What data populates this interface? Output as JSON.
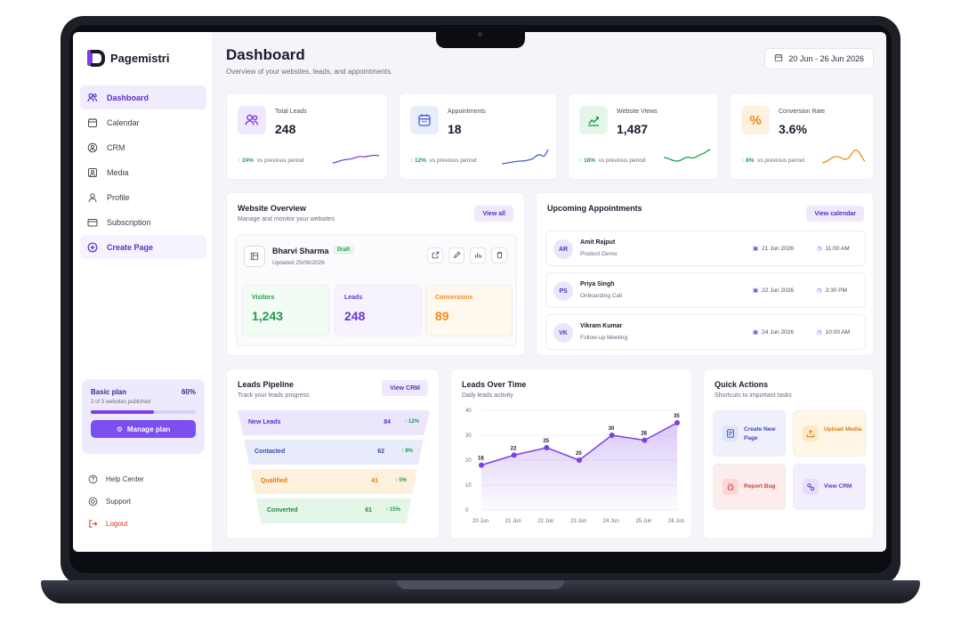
{
  "app": {
    "name": "Pagemistri"
  },
  "nav": {
    "items": [
      {
        "label": "Dashboard",
        "icon": "dashboard-icon"
      },
      {
        "label": "Calendar",
        "icon": "calendar-icon"
      },
      {
        "label": "CRM",
        "icon": "crm-icon"
      },
      {
        "label": "Media",
        "icon": "media-icon"
      },
      {
        "label": "Profile",
        "icon": "profile-icon"
      },
      {
        "label": "Subscription",
        "icon": "subscription-icon"
      },
      {
        "label": "Create Page",
        "icon": "plus-circle-icon"
      }
    ]
  },
  "plan": {
    "name": "Basic plan",
    "percent_label": "60%",
    "percent": 0.6,
    "sub": "2 of 3 websites published",
    "button": "Manage plan"
  },
  "footer_nav": {
    "help": "Help Center",
    "support": "Support",
    "logout": "Logout"
  },
  "header": {
    "title": "Dashboard",
    "subtitle": "Overview of your websites, leads, and appointments.",
    "date_range": "20 Jun - 26 Jun 2026"
  },
  "stats": [
    {
      "label": "Total Leads",
      "value": "248",
      "change": "↑ 24%",
      "note": "vs previous period",
      "color": "#7b3fe4",
      "bg": "#efe9fd",
      "icon": "users-icon"
    },
    {
      "label": "Appointments",
      "value": "18",
      "change": "↑ 12%",
      "note": "vs previous period",
      "color": "#4b5fd6",
      "bg": "#e9ecfb",
      "icon": "calendar-icon"
    },
    {
      "label": "Website Views",
      "value": "1,487",
      "change": "↑ 18%",
      "note": "vs previous period",
      "color": "#1f9d4c",
      "bg": "#e4f6ea",
      "icon": "chart-up-icon"
    },
    {
      "label": "Conversion Rate",
      "value": "3.6%",
      "change": "↑ 8%",
      "note": "vs previous period",
      "color": "#f08a1c",
      "bg": "#fdf1e2",
      "icon": "percent-icon"
    }
  ],
  "website_overview": {
    "title": "Website Overview",
    "subtitle": "Manage and monitor your websites",
    "button": "View all",
    "site": {
      "name": "Bharvi Sharma",
      "status": "Draft",
      "updated": "Updated 25/06/2026"
    },
    "metrics": [
      {
        "label": "Visitors",
        "value": "1,243",
        "color": "#1f9d4c",
        "bg": "#f3fbf5"
      },
      {
        "label": "Leads",
        "value": "248",
        "color": "#6a33d8",
        "bg": "#f6f3fe"
      },
      {
        "label": "Conversions",
        "value": "89",
        "color": "#f08a1c",
        "bg": "#fff8ee"
      }
    ]
  },
  "appointments": {
    "title": "Upcoming Appointments",
    "button": "View calendar",
    "items": [
      {
        "initials": "AR",
        "name": "Amit Rajput",
        "type": "Product Demo",
        "date": "21 Jun 2026",
        "time": "11:00 AM"
      },
      {
        "initials": "PS",
        "name": "Priya Singh",
        "type": "Onboarding Call",
        "date": "22 Jun 2026",
        "time": "3:30 PM"
      },
      {
        "initials": "VK",
        "name": "Vikram Kumar",
        "type": "Follow-up Meeting",
        "date": "24 Jun 2026",
        "time": "10:00 AM"
      }
    ]
  },
  "pipeline": {
    "title": "Leads Pipeline",
    "subtitle": "Track your leads progress",
    "button": "View CRM",
    "stages": [
      {
        "name": "New Leads",
        "value": "84",
        "change": "↑ 12%",
        "bg": "#ece6fd",
        "color": "#5b2fc9"
      },
      {
        "name": "Contacted",
        "value": "62",
        "change": "↑ 8%",
        "bg": "#e8ebfb",
        "color": "#3949b5"
      },
      {
        "name": "Qualified",
        "value": "41",
        "change": "↑ 5%",
        "bg": "#fdf1de",
        "color": "#e07a0e"
      },
      {
        "name": "Converted",
        "value": "61",
        "change": "↑ 15%",
        "bg": "#e3f6e8",
        "color": "#1f8a44"
      }
    ]
  },
  "chart_data": {
    "type": "area",
    "title": "Leads Over Time",
    "subtitle": "Daily leads activity",
    "categories": [
      "20 Jun",
      "21 Jun",
      "22 Jun",
      "23 Jun",
      "24 Jun",
      "25 Jun",
      "26 Jun"
    ],
    "values": [
      18,
      22,
      25,
      20,
      30,
      28,
      35
    ],
    "yticks": [
      0,
      10,
      20,
      30,
      40
    ],
    "ylim": [
      0,
      40
    ],
    "color": "#7b3fe4",
    "grid": true
  },
  "quick_actions": {
    "title": "Quick Actions",
    "subtitle": "Shortcuts to important tasks",
    "items": [
      {
        "label": "Create New Page",
        "bg": "#eef1fc",
        "color": "#3949b5",
        "icon": "new-page-icon"
      },
      {
        "label": "Upload Media",
        "bg": "#fff6e6",
        "color": "#e07a0e",
        "icon": "upload-icon"
      },
      {
        "label": "Report Bug",
        "bg": "#fdecec",
        "color": "#d83a34",
        "icon": "bug-icon"
      },
      {
        "label": "View CRM",
        "bg": "#f2eefd",
        "color": "#5b2fc9",
        "icon": "crm-icon"
      }
    ]
  }
}
